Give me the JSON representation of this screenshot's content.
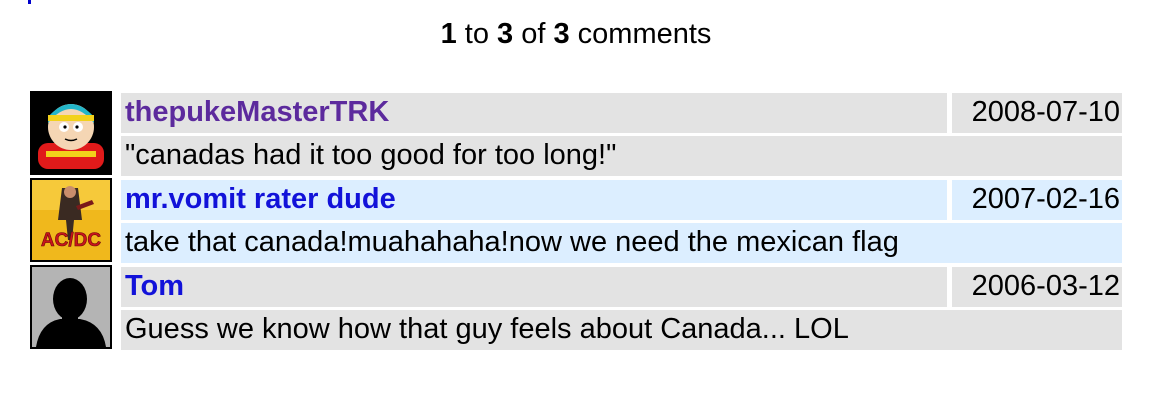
{
  "pager": {
    "start": "1",
    "to_word": "to",
    "end": "3",
    "of_word": "of",
    "total": "3",
    "suffix": "comments"
  },
  "comments": [
    {
      "author": "thepukeMasterTRK",
      "date": "2008-07-10",
      "text": "\"canadas had it too good for too long!\"",
      "avatar_icon": "cartman-avatar-icon",
      "row_color": "#e3e3e3",
      "author_color": "#5c2a9d"
    },
    {
      "author": "mr.vomit rater dude",
      "date": "2007-02-16",
      "text": "take that canada!muahahaha!now we need the mexican flag",
      "avatar_icon": "acdc-avatar-icon",
      "avatar_logo_text": "AC/DC",
      "row_color": "#dceeff",
      "author_color": "#1212d9"
    },
    {
      "author": "Tom",
      "date": "2006-03-12",
      "text": "Guess we know how that guy feels about Canada... LOL",
      "avatar_icon": "silhouette-avatar-icon",
      "row_color": "#e3e3e3",
      "author_color": "#1212d9"
    }
  ]
}
